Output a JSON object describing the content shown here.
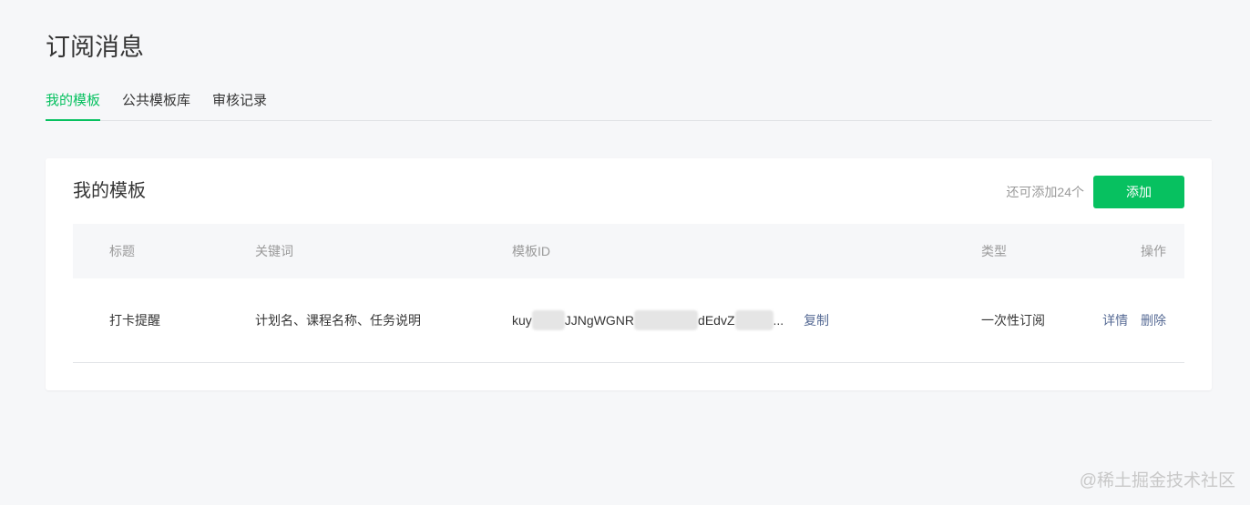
{
  "page": {
    "title": "订阅消息"
  },
  "tabs": [
    {
      "label": "我的模板",
      "active": true
    },
    {
      "label": "公共模板库",
      "active": false
    },
    {
      "label": "审核记录",
      "active": false
    }
  ],
  "card": {
    "title": "我的模板",
    "remaining_text": "还可添加24个",
    "add_label": "添加"
  },
  "table": {
    "headers": {
      "title": "标题",
      "keywords": "关键词",
      "template_id": "模板ID",
      "type": "类型",
      "actions": "操作"
    },
    "rows": [
      {
        "title": "打卡提醒",
        "keywords": "计划名、课程名称、任务说明",
        "id_part1": "kuy",
        "id_part2": "JJNgWGNR",
        "id_part3": "dEdvZ",
        "id_ellipsis": "...",
        "copy_label": "复制",
        "type": "一次性订阅",
        "detail_label": "详情",
        "delete_label": "删除"
      }
    ]
  },
  "watermark": "@稀土掘金技术社区",
  "colors": {
    "accent": "#07c160",
    "link": "#576b95",
    "background": "#f6f7f9",
    "muted_text": "#9a9a9a"
  }
}
